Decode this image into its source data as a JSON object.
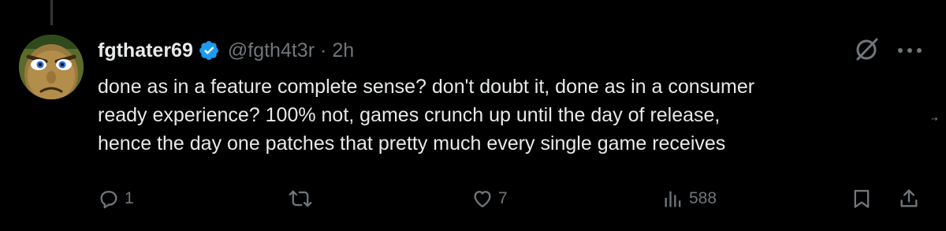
{
  "tweet": {
    "author": {
      "display_name": "fgthater69",
      "handle": "@fgth4t3r",
      "verified": true,
      "avatar_icon": "cartoon-face-avatar"
    },
    "separator": "·",
    "time": "2h",
    "text": "done as in a feature complete sense? don't doubt it, done as in a consumer\nready experience? 100% not, games crunch up until the day of release,\nhence the day one patches that pretty much every single game receives",
    "actions": {
      "replies": "1",
      "reposts": "",
      "likes": "7",
      "views": "588"
    },
    "side_arrow": "→"
  },
  "colors": {
    "background": "#000000",
    "primary_text": "#e7e9ea",
    "secondary_text": "#71767b",
    "verified_blue": "#1d9bf0",
    "thread_line": "#333639"
  }
}
